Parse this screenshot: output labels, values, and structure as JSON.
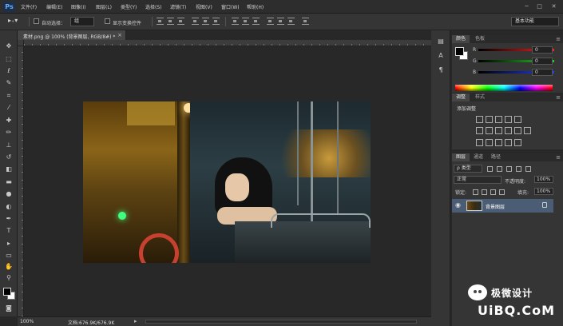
{
  "app": {
    "logo": "Ps"
  },
  "menu": [
    {
      "label": "文件(F)"
    },
    {
      "label": "编辑(E)"
    },
    {
      "label": "图像(I)"
    },
    {
      "label": "图层(L)"
    },
    {
      "label": "类型(Y)"
    },
    {
      "label": "选择(S)"
    },
    {
      "label": "滤镜(T)"
    },
    {
      "label": "视图(V)"
    },
    {
      "label": "窗口(W)"
    },
    {
      "label": "帮助(H)"
    }
  ],
  "window_controls": {
    "minimize": "─",
    "maximize": "□",
    "close": "✕"
  },
  "options": {
    "auto_select_label": "自动选择：",
    "auto_select_value": "组",
    "show_transform_label": "显示变换控件",
    "workspace": "基本功能"
  },
  "document": {
    "tab_title": "素材.png @ 100% (背景图层, RGB/8#) *",
    "close": "×"
  },
  "status": {
    "zoom": "100%",
    "doc_size": "文档:676.9K/676.9K",
    "arrow": "▸"
  },
  "tools": [
    {
      "name": "move-tool",
      "glyph": "✥"
    },
    {
      "name": "marquee-tool",
      "glyph": "⬚"
    },
    {
      "name": "lasso-tool",
      "glyph": "ℓ"
    },
    {
      "name": "quick-select-tool",
      "glyph": "✎"
    },
    {
      "name": "crop-tool",
      "glyph": "⌗"
    },
    {
      "name": "eyedropper-tool",
      "glyph": "⁄"
    },
    {
      "name": "healing-tool",
      "glyph": "✚"
    },
    {
      "name": "brush-tool",
      "glyph": "✏"
    },
    {
      "name": "stamp-tool",
      "glyph": "⊥"
    },
    {
      "name": "history-brush-tool",
      "glyph": "↺"
    },
    {
      "name": "eraser-tool",
      "glyph": "◧"
    },
    {
      "name": "gradient-tool",
      "glyph": "▬"
    },
    {
      "name": "blur-tool",
      "glyph": "●"
    },
    {
      "name": "dodge-tool",
      "glyph": "◐"
    },
    {
      "name": "pen-tool",
      "glyph": "✒"
    },
    {
      "name": "type-tool",
      "glyph": "T"
    },
    {
      "name": "path-select-tool",
      "glyph": "▸"
    },
    {
      "name": "shape-tool",
      "glyph": "▭"
    },
    {
      "name": "hand-tool",
      "glyph": "✋"
    },
    {
      "name": "zoom-tool",
      "glyph": "⚲"
    }
  ],
  "color_panel": {
    "tabs": [
      "颜色",
      "色板"
    ],
    "channels": [
      {
        "label": "R",
        "value": "0",
        "color": "#ff2020"
      },
      {
        "label": "G",
        "value": "0",
        "color": "#20d020"
      },
      {
        "label": "B",
        "value": "0",
        "color": "#2040ff"
      }
    ]
  },
  "adjustments_panel": {
    "tabs": [
      "调整",
      "样式"
    ],
    "title": "添加调整"
  },
  "layers_panel": {
    "tabs": [
      "图层",
      "通道",
      "路径"
    ],
    "filter_label": "ρ 类型",
    "blend_mode": "正常",
    "opacity_label": "不透明度:",
    "opacity": "100%",
    "lock_label": "锁定:",
    "fill_label": "填充:",
    "fill": "100%",
    "layers": [
      {
        "name": "背景图层",
        "visible": true,
        "locked": true
      }
    ]
  },
  "watermark": {
    "cn": "极微设计",
    "en": "UiBQ.CoM"
  }
}
